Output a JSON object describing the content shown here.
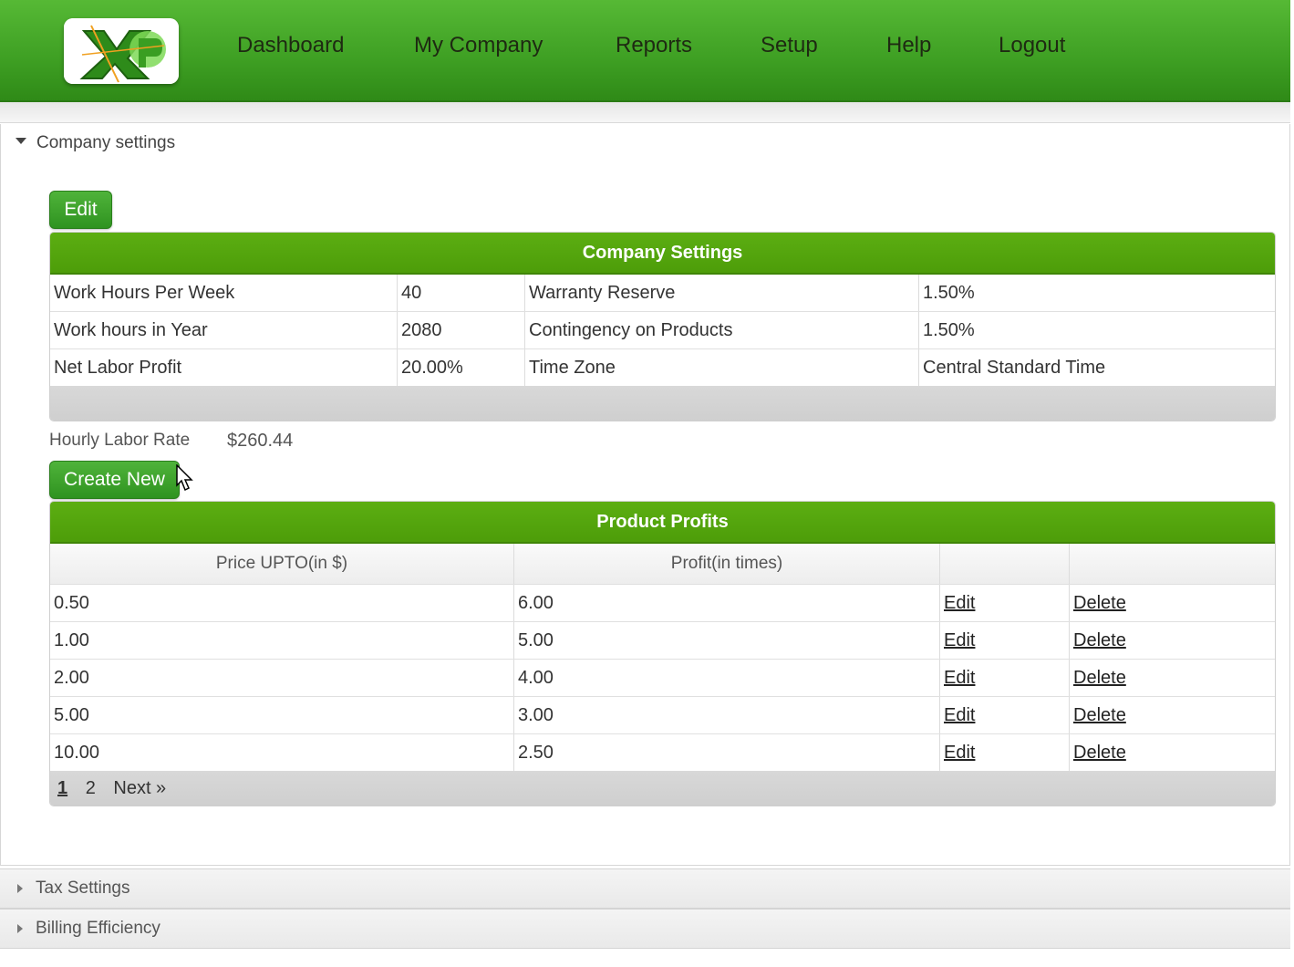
{
  "nav": {
    "items": [
      {
        "label": "Dashboard"
      },
      {
        "label": "My Company"
      },
      {
        "label": "Reports"
      },
      {
        "label": "Setup"
      },
      {
        "label": "Help"
      },
      {
        "label": "Logout"
      }
    ]
  },
  "sections": {
    "company_settings": {
      "label": "Company settings"
    },
    "tax_settings": {
      "label": "Tax Settings"
    },
    "billing_efficiency": {
      "label": "Billing Efficiency"
    }
  },
  "company_settings": {
    "edit_label": "Edit",
    "table_title": "Company Settings",
    "rows": [
      {
        "label1": "Work Hours Per Week",
        "value1": "40",
        "label2": "Warranty Reserve",
        "value2": "1.50%"
      },
      {
        "label1": "Work hours in Year",
        "value1": "2080",
        "label2": "Contingency on Products",
        "value2": "1.50%"
      },
      {
        "label1": "Net Labor Profit",
        "value1": "20.00%",
        "label2": "Time Zone",
        "value2": "Central Standard Time"
      }
    ],
    "hourly_rate_label": "Hourly Labor Rate",
    "hourly_rate_value": "$260.44"
  },
  "product_profits": {
    "create_label": "Create New",
    "table_title": "Product Profits",
    "columns": [
      "Price UPTO(in $)",
      "Profit(in times)",
      "",
      ""
    ],
    "rows": [
      {
        "price": "0.50",
        "profit": "6.00",
        "edit": "Edit",
        "delete": "Delete"
      },
      {
        "price": "1.00",
        "profit": "5.00",
        "edit": "Edit",
        "delete": "Delete"
      },
      {
        "price": "2.00",
        "profit": "4.00",
        "edit": "Edit",
        "delete": "Delete"
      },
      {
        "price": "5.00",
        "profit": "3.00",
        "edit": "Edit",
        "delete": "Delete"
      },
      {
        "price": "10.00",
        "profit": "2.50",
        "edit": "Edit",
        "delete": "Delete"
      }
    ],
    "pager": {
      "pages": [
        "1",
        "2"
      ],
      "current": "1",
      "next": "Next »"
    }
  },
  "theme": {
    "accent": "#4d9d09",
    "nav_bg": "#3e9f23"
  },
  "icons": {
    "logo": "xp-logo",
    "cursor": "mouse-pointer-icon"
  }
}
